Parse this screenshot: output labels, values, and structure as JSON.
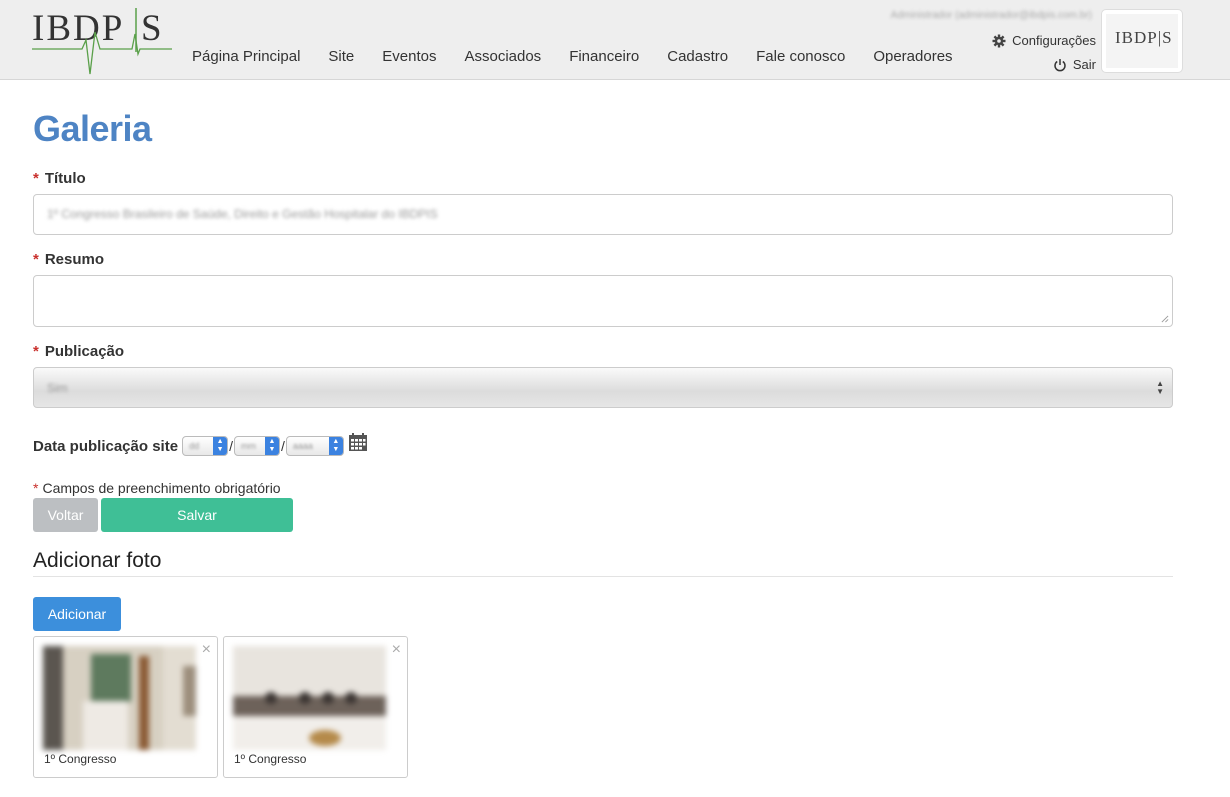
{
  "header": {
    "logo_text": "IBDP|S",
    "nav": [
      "Página Principal",
      "Site",
      "Eventos",
      "Associados",
      "Financeiro",
      "Cadastro",
      "Fale conosco",
      "Operadores"
    ],
    "user_label": "Administrador (administrador@ibdpis.com.br)",
    "settings_label": "Configurações",
    "logout_label": "Sair",
    "avatar_text": "IBDP|S"
  },
  "page": {
    "title": "Galeria"
  },
  "form": {
    "required_mark": "*",
    "title_label": "Título",
    "title_value": "1º Congresso Brasileiro de Saúde, Direito e Gestão Hospitalar do IBDPIS",
    "summary_label": "Resumo",
    "summary_value": "",
    "publication_label": "Publicação",
    "publication_value": "Sim",
    "date_label": "Data publicação site",
    "date_day": "dd",
    "date_month": "mm",
    "date_year": "aaaa",
    "date_sep": "/",
    "required_note": "Campos de preenchimento obrigatório",
    "back_label": "Voltar",
    "save_label": "Salvar"
  },
  "photos": {
    "section_title": "Adicionar foto",
    "add_label": "Adicionar",
    "close_glyph": "×",
    "items": [
      {
        "caption": "1º Congresso"
      },
      {
        "caption": "1º Congresso"
      }
    ]
  },
  "colors": {
    "title_blue": "#4e84c4",
    "required_red": "#c9302c",
    "save_green": "#3fbf96",
    "add_blue": "#3c8fdc",
    "back_gray": "#bcbfc2"
  }
}
